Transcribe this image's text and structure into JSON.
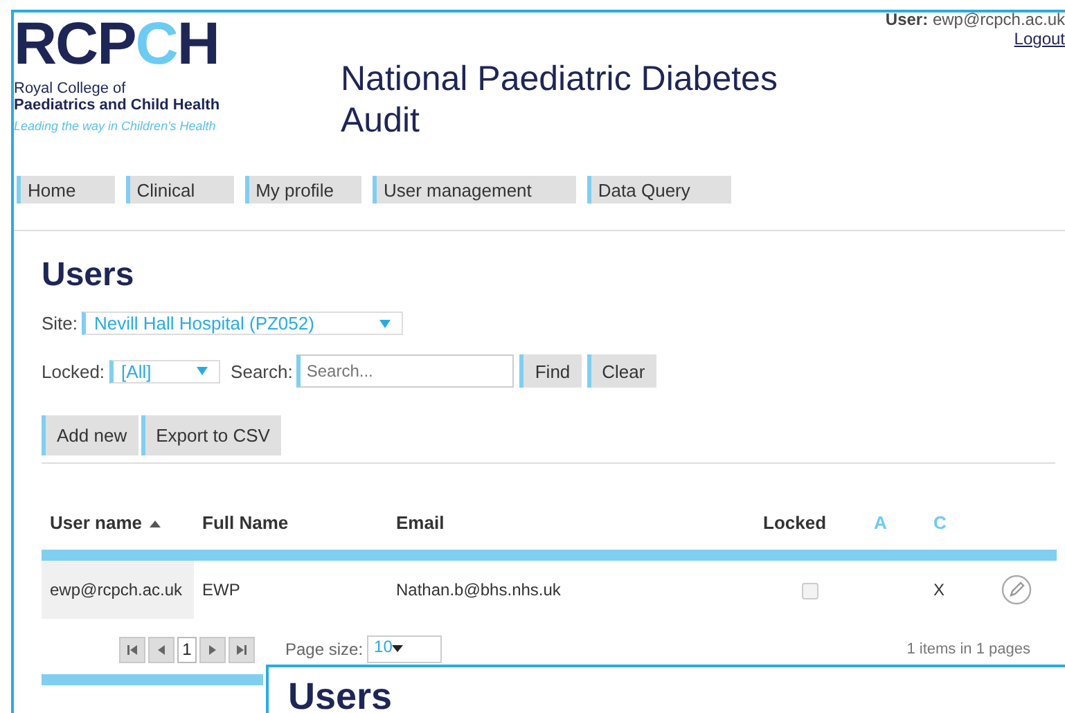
{
  "logo": {
    "mark": [
      {
        "text": "RCP",
        "accent": false
      },
      {
        "text": "C",
        "accent": true
      },
      {
        "text": "H",
        "accent": false
      }
    ],
    "line_1": "Royal College of",
    "line_2": "Paediatrics and Child Health",
    "tagline": "Leading the way in Children's Health"
  },
  "title": "National Paediatric Diabetes Audit",
  "user": {
    "label": "User:",
    "email": "ewp@rcpch.ac.uk",
    "logout": "Logout"
  },
  "nav": [
    {
      "label": "Home"
    },
    {
      "label": "Clinical"
    },
    {
      "label": "My profile"
    },
    {
      "label": "User management"
    },
    {
      "label": "Data Query"
    }
  ],
  "heading": "Users",
  "site": {
    "label": "Site:",
    "value": "Nevill Hall Hospital (PZ052)"
  },
  "locked_filter": {
    "label": "Locked:",
    "value": "[All]"
  },
  "search": {
    "label": "Search:",
    "placeholder": "Search..."
  },
  "search_buttons": [
    "Find",
    "Clear"
  ],
  "actions": [
    "Add new",
    "Export to CSV"
  ],
  "table": {
    "columns": [
      {
        "label": "User name",
        "kind": "text",
        "sorted": true
      },
      {
        "label": "Full Name",
        "kind": "text",
        "sorted": false
      },
      {
        "label": "Email",
        "kind": "text",
        "sorted": false
      },
      {
        "label": "Locked",
        "kind": "text",
        "sorted": false
      },
      {
        "label": "A",
        "kind": "flag",
        "sorted": false
      },
      {
        "label": "C",
        "kind": "flag",
        "sorted": false
      }
    ],
    "rows": [
      {
        "user_name": "ewp@rcpch.ac.uk",
        "full_name": "EWP",
        "email": "Nathan.b@bhs.nhs.uk",
        "locked": false,
        "c": "X"
      }
    ]
  },
  "pager": {
    "page": "1",
    "page_size_label": "Page size:",
    "page_size": "10",
    "summary": "1 items in 1 pages"
  },
  "overlay": {
    "heading": "Users"
  }
}
